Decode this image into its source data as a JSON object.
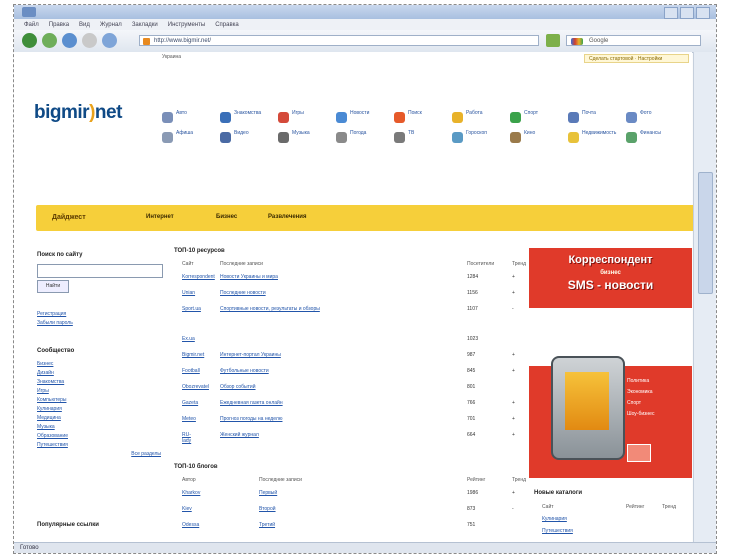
{
  "browser": {
    "menu_items": [
      "Файл",
      "Правка",
      "Вид",
      "Журнал",
      "Закладки",
      "Инструменты",
      "Справка"
    ],
    "address": "http://www.bigmir.net/",
    "search_placeholder": "Google",
    "status": "Готово"
  },
  "site": {
    "logo_main": "bigmir",
    "logo_accent": ")",
    "logo_tail": "net",
    "top_link_left": "Украина",
    "top_links": "Сделать стартовой · Настройки",
    "categories": [
      "Авто",
      "Знакомства",
      "Игры",
      "Новости",
      "Поиск",
      "Работа",
      "Спорт",
      "Почта",
      "Фото",
      "Афиша",
      "Видео",
      "Музыка",
      "Погода",
      "ТВ",
      "Гороскоп",
      "Кино",
      "Недвижимость",
      "Финансы"
    ],
    "yellow_bar": {
      "main": "Дайджест",
      "tabs": [
        "Интернет",
        "Бизнес",
        "Развлечения"
      ]
    },
    "left": {
      "search_title": "Поиск по сайту",
      "search_button": "Найти",
      "reg_links": [
        "Регистрация",
        "Забыли пароль"
      ],
      "section_title": "Сообщество",
      "links": [
        "Бизнес",
        "Дизайн",
        "Знакомства",
        "Игры",
        "Компьютеры",
        "Кулинария",
        "Медицина",
        "Музыка",
        "Образование",
        "Путешествия"
      ],
      "more_link": "Все разделы",
      "bottom_title": "Популярные ссылки"
    },
    "top_table": {
      "title": "ТОП-10 ресурсов",
      "head": [
        "Сайт",
        "Последние записи",
        "Посетители",
        "Тренд"
      ],
      "rows": [
        [
          "Korrespondent",
          "Новости Украины и мира",
          "1284",
          "+"
        ],
        [
          "Unian",
          "Последние новости",
          "1156",
          "+"
        ],
        [
          "Sport.ua",
          "Спортивные новости, результаты и обзоры",
          "1107",
          "-"
        ],
        [
          "Ex.ua",
          "",
          "1023",
          ""
        ],
        [
          "Bigmir.net",
          "Интернет-портал Украины",
          "987",
          "+"
        ],
        [
          "Football",
          "Футбольные новости",
          "845",
          "+"
        ],
        [
          "Obozrevatel",
          "Обзор событий",
          "801",
          ""
        ],
        [
          "Gazeta",
          "Ежедневная газета онлайн",
          "766",
          "+"
        ],
        [
          "Meteo",
          "Прогноз погоды на неделю",
          "701",
          "+"
        ],
        [
          "RU-lady",
          "Женский журнал",
          "664",
          "+"
        ]
      ]
    },
    "blog_table": {
      "title": "ТОП-10 блогов",
      "head": [
        "Автор",
        "Последние записи",
        "Рейтинг",
        "Тренд"
      ],
      "rows": [
        [
          "Kharkov",
          "Первый",
          "1986",
          "+"
        ],
        [
          "Kiev",
          "Второй",
          "873",
          "-"
        ],
        [
          "Odessa",
          "Третий",
          "751",
          ""
        ]
      ]
    },
    "ad": {
      "line1": "Корреспондент",
      "line2": "бизнес",
      "line3": "SMS - новости",
      "bullets": [
        "Политика",
        "Экономика",
        "Спорт",
        "Шоу-бизнес"
      ]
    },
    "right_box": {
      "title": "Новые каталоги",
      "head": [
        "Сайт",
        "Рейтинг",
        "Тренд"
      ],
      "rows": [
        "Кулинария",
        "Путешествия"
      ]
    }
  },
  "colors": {
    "yellow_bar": "#f6cf3a",
    "ad_red": "#e03a2a",
    "link": "#2255aa",
    "logo": "#0f4a86"
  }
}
